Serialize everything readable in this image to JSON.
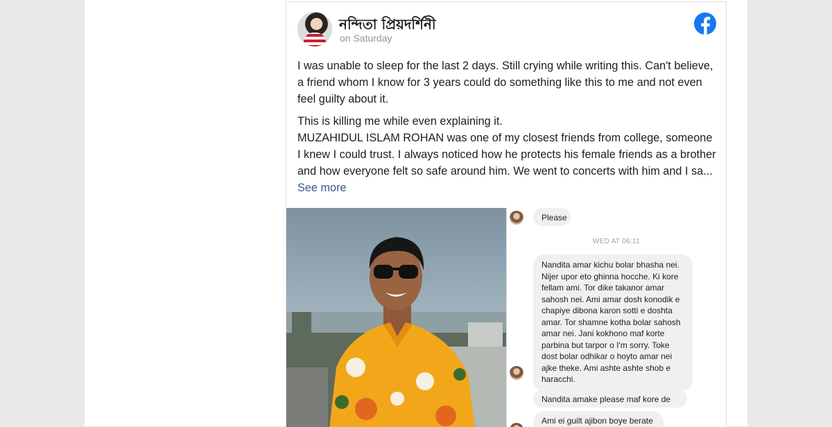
{
  "post": {
    "author_name": "নন্দিতা প্রিয়দর্শিনী",
    "timestamp": "on Saturday",
    "paragraph1": "I was unable to sleep for the last 2 days. Still crying while writing this. Can't believe, a friend whom I know for 3 years could do something like this to me and not even feel guilty about it.",
    "paragraph2_line1": "This is killing me while even explaining it.",
    "paragraph2_rest": "MUZAHIDUL ISLAM ROHAN was one of my closest friends from college, someone I knew I could trust. I always noticed how he protects his female friends as a brother and how everyone felt so safe around him. We went to concerts with him and I sa...",
    "see_more": "See more"
  },
  "chat": {
    "timestamp": "WED AT 06:11",
    "messages": [
      "Please",
      "Nandita amar kichu bolar bhasha nei. Nijer upor eto ghinna hocche. Ki kore fellam ami. Tor dike takanor amar sahosh nei. Ami amar dosh konodik e chapiye dibona karon sotti e doshta amar. Tor shamne kotha bolar sahosh amar nei. Jani kokhono maf korte parbina but tarpor o I'm sorry. Toke dost bolar odhikar o hoyto amar nei ajke theke. Ami ashte ashte shob e haracchi.",
      "Nandita amake please maf kore de",
      "Ami ei guilt ajibon boye berate"
    ]
  },
  "icons": {
    "brand": "facebook-icon",
    "brand_color": "#1877f2"
  }
}
